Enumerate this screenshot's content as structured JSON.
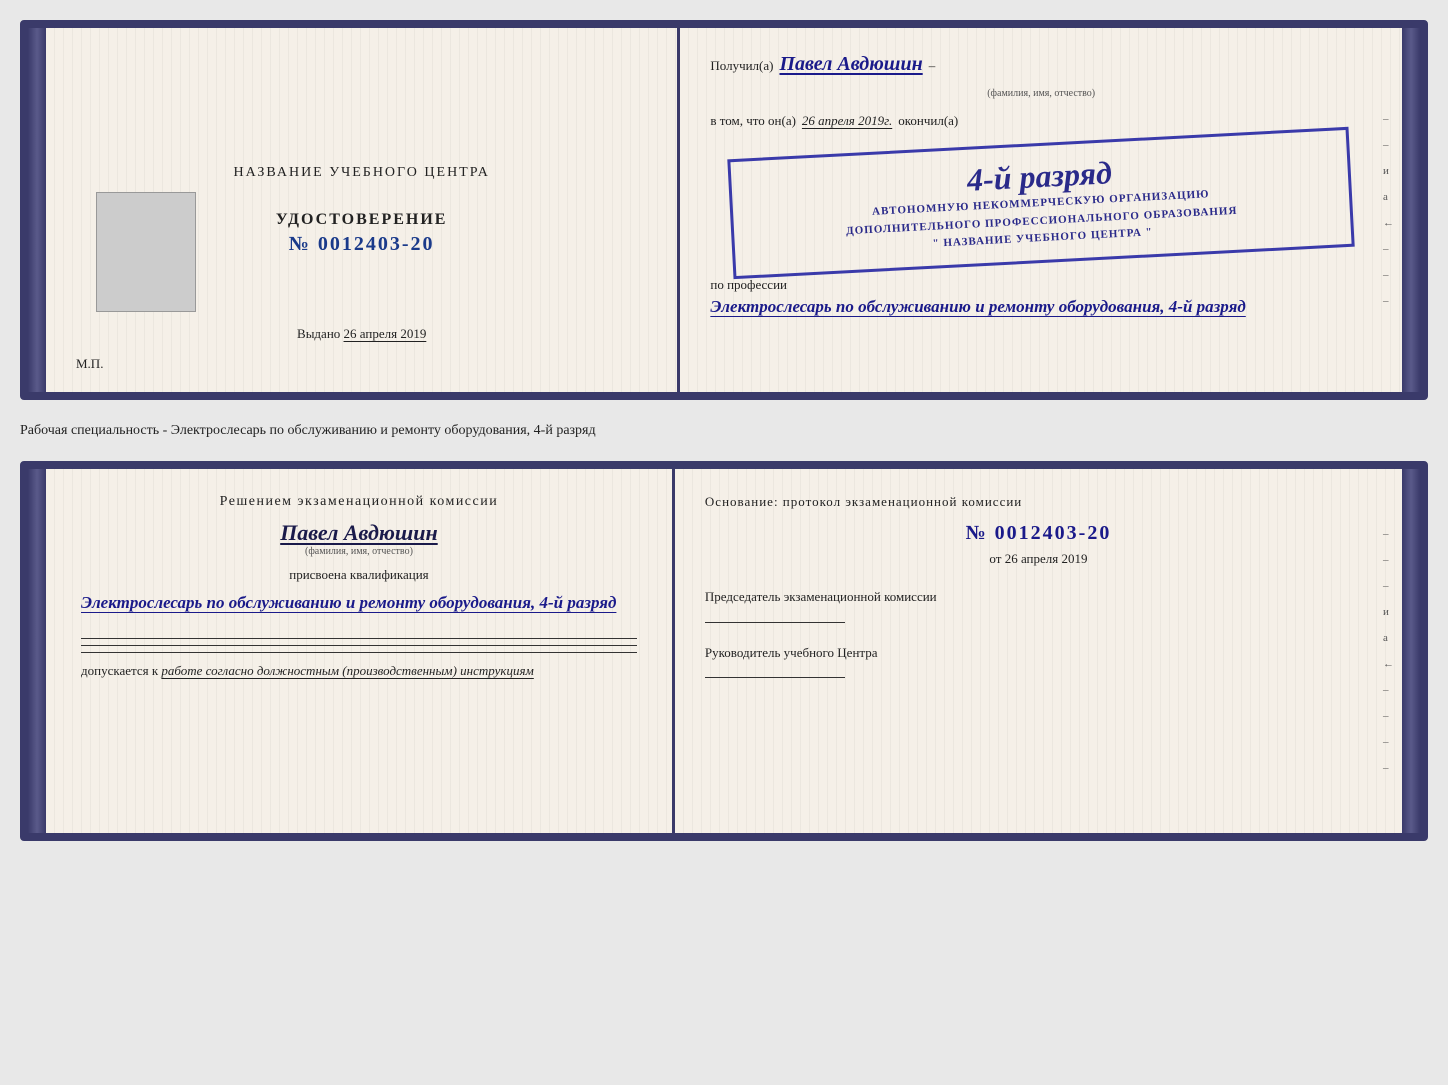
{
  "top_doc": {
    "left": {
      "center_title": "НАЗВАНИЕ УЧЕБНОГО ЦЕНТРА",
      "udostoverenie_label": "УДОСТОВЕРЕНИЕ",
      "udostoverenie_number": "№ 0012403-20",
      "vydano_prefix": "Выдано",
      "vydano_date": "26 апреля 2019",
      "mp_label": "М.П."
    },
    "right": {
      "received_prefix": "Получил(a)",
      "received_name": "Павел Авдюшин",
      "dash": "–",
      "fio_hint": "(фамилия, имя, отчество)",
      "vtom_prefix": "в том, что он(а)",
      "vtom_date": "26 апреля 2019г.",
      "okoncil": "окончил(а)",
      "stamp_line1": "4-й разряд",
      "stamp_line2": "АВТОНОМНУЮ НЕКОММЕРЧЕСКУЮ ОРГАНИЗАЦИЮ",
      "stamp_line3": "ДОПОЛНИТЕЛЬНОГО ПРОФЕССИОНАЛЬНОГО ОБРАЗОВАНИЯ",
      "stamp_line4": "\" НАЗВАНИЕ УЧЕБНОГО ЦЕНТРА \"",
      "profession_prefix": "по профессии",
      "profession_value": "Электрослесарь по обслуживанию и ремонту оборудования, 4-й разряд"
    }
  },
  "separator": {
    "text": "Рабочая специальность - Электрослесарь по обслуживанию и ремонту оборудования, 4-й разряд"
  },
  "bottom_doc": {
    "left": {
      "komissia_title": "Решением экзаменационной комиссии",
      "person_name": "Павел Авдюшин",
      "fio_hint": "(фамилия, имя, отчество)",
      "prisvoena_label": "присвоена квалификация",
      "qualification_value": "Электрослесарь по обслуживанию и ремонту оборудования, 4-й разряд",
      "dopusk_prefix": "допускается к",
      "dopusk_value": "работе согласно должностным (производственным) инструкциям"
    },
    "right": {
      "osnovanie_title": "Основание: протокол экзаменационной комиссии",
      "protocol_number": "№ 0012403-20",
      "ot_prefix": "от",
      "ot_date": "26 апреля 2019",
      "predsedatel_title": "Председатель экзаменационной комиссии",
      "rukovoditel_title": "Руководитель учебного Центра"
    },
    "side_marks": [
      "–",
      "–",
      "–",
      "и",
      "а",
      "←",
      "–",
      "–",
      "–",
      "–"
    ]
  }
}
